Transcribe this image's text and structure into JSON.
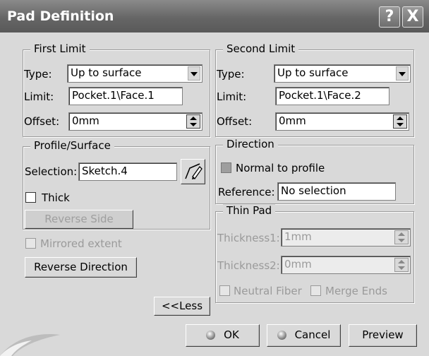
{
  "window": {
    "title": "Pad Definition",
    "help_icon": "?",
    "close_icon": "X"
  },
  "first_limit": {
    "legend": "First Limit",
    "type_label": "Type:",
    "type_value": "Up to surface",
    "limit_label": "Limit:",
    "limit_value": "Pocket.1\\Face.1",
    "offset_label": "Offset:",
    "offset_value": "0mm"
  },
  "second_limit": {
    "legend": "Second Limit",
    "type_label": "Type:",
    "type_value": "Up to surface",
    "limit_label": "Limit:",
    "limit_value": "Pocket.1\\Face.2",
    "offset_label": "Offset:",
    "offset_value": "0mm"
  },
  "profile": {
    "legend": "Profile/Surface",
    "selection_label": "Selection:",
    "selection_value": "Sketch.4",
    "thick_label": "Thick",
    "thick_checked": false,
    "reverse_side_label": "Reverse Side"
  },
  "direction": {
    "legend": "Direction",
    "normal_label": "Normal to profile",
    "normal_checked": true,
    "reference_label": "Reference:",
    "reference_value": "No selection"
  },
  "mirrored": {
    "label": "Mirrored extent",
    "checked": false
  },
  "reverse_direction_label": "Reverse Direction",
  "thin_pad": {
    "legend": "Thin Pad",
    "thickness1_label": "Thickness1:",
    "thickness1_value": "1mm",
    "thickness2_label": "Thickness2:",
    "thickness2_value": "0mm",
    "neutral_fiber_label": "Neutral Fiber",
    "merge_ends_label": "Merge Ends"
  },
  "less_label": "<<Less",
  "footer": {
    "ok_label": "OK",
    "cancel_label": "Cancel",
    "preview_label": "Preview"
  }
}
